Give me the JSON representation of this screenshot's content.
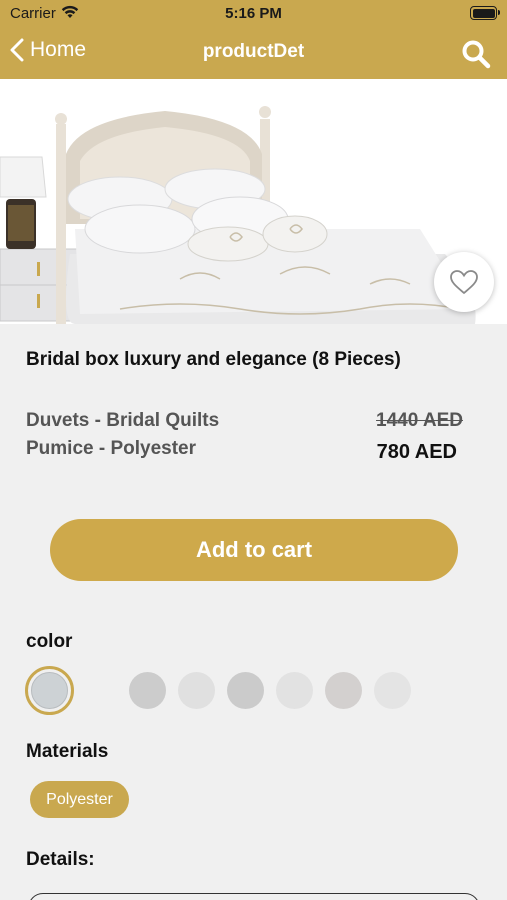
{
  "status_bar": {
    "carrier": "Carrier",
    "time": "5:16 PM"
  },
  "nav": {
    "back_label": "Home",
    "title": "productDet",
    "search_icon": "search-icon"
  },
  "product": {
    "title": "Bridal box luxury and elegance (8 Pieces)",
    "subtitle_line1": "Duvets - Bridal Quilts",
    "subtitle_line2": "Pumice - Polyester",
    "old_price": "1440 AED",
    "new_price": "780 AED",
    "favorite_icon": "heart-outline-icon"
  },
  "actions": {
    "add_to_cart": "Add to cart"
  },
  "color_section": {
    "label": "color",
    "selected": "#cdd2d5",
    "swatches": [
      "#cccccc",
      "#e0e0e0",
      "#cbcbcb",
      "#e2e2e2",
      "#d3d0cf",
      "#e4e4e4"
    ]
  },
  "materials_section": {
    "label": "Materials",
    "options": [
      "Polyester"
    ]
  },
  "details_section": {
    "label": "Details:"
  },
  "theme": {
    "accent": "#c9a84f",
    "button": "#cea94b"
  }
}
